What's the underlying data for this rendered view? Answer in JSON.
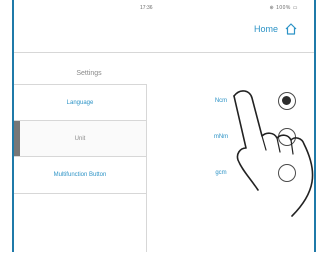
{
  "status_bar": {
    "time": "17:36",
    "icons": "⊕ 100% ▭"
  },
  "header": {
    "home_label": "Home"
  },
  "page": {
    "title": "Settings"
  },
  "menu": {
    "items": [
      {
        "label": "Language"
      },
      {
        "label": "Unit"
      },
      {
        "label": "Multifunction Button"
      }
    ]
  },
  "unit_options": [
    {
      "label": "Ncm",
      "selected": true
    },
    {
      "label": "mNm",
      "selected": false
    },
    {
      "label": "gcm",
      "selected": false
    }
  ],
  "colors": {
    "accent": "#2c93c6",
    "frame": "#1f7aa9"
  }
}
